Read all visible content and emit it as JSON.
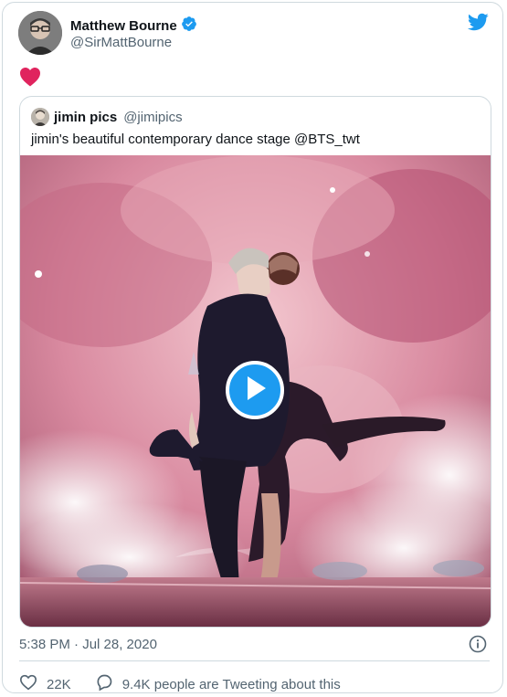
{
  "author": {
    "name": "Matthew Bourne",
    "handle": "@SirMattBourne",
    "verified": true
  },
  "tweet": {
    "content_emoji": "heart",
    "timestamp": "5:38 PM · Jul 28, 2020"
  },
  "quoted": {
    "name": "jimin pics",
    "handle": "@jimipics",
    "text": "jimin's beautiful contemporary dance stage @BTS_twt"
  },
  "stats": {
    "likes": "22K",
    "conversation": "9.4K people are Tweeting about this"
  },
  "icons": [
    "verified-badge-icon",
    "twitter-bird-icon",
    "red-heart-icon",
    "play-icon",
    "info-icon",
    "heart-outline-icon",
    "speech-bubble-icon"
  ],
  "colors": {
    "brand_blue": "#1d9bf0",
    "heart_red": "#e0245e",
    "secondary_text": "#536471",
    "border": "#cfd9de"
  }
}
